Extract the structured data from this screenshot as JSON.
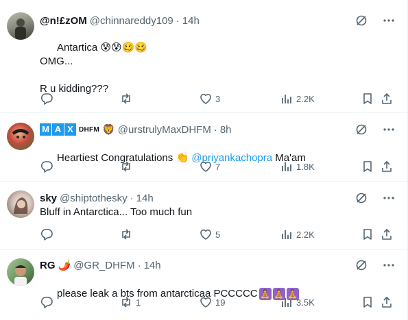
{
  "tweets": [
    {
      "name": "@n!£zOM",
      "handle": "@chinnareddy109",
      "separator": "·",
      "time": "14h",
      "text_lead": "Antartica ",
      "emojis": [
        "😰",
        "😰",
        "🥴",
        "🥴"
      ],
      "text_rest": "OMG...\n\nR u kidding???",
      "replies": "",
      "retweets": "",
      "likes": "3",
      "views": "2.2K",
      "avatar_colors": [
        "#8a8f82",
        "#3d3d35"
      ]
    },
    {
      "name_badge": [
        "M",
        "A",
        "X"
      ],
      "name_suffix": "DHFM",
      "name_emoji": "🦁",
      "handle": "@urstrulyMaxDHFM",
      "separator": "·",
      "time": "8h",
      "text_lead": "Heartiest Congratulations ",
      "emoji": "👏",
      "mention": "@priyankachopra",
      "text_tail": " Ma'am",
      "replies": "",
      "retweets": "",
      "likes": "7",
      "views": "1.8K",
      "avatar_colors": [
        "#c24a3d",
        "#2f7a3a"
      ]
    },
    {
      "name": "sky",
      "handle": "@shiptothesky",
      "separator": "·",
      "time": "14h",
      "text": "Bluff in Antarctica... Too much fun",
      "replies": "",
      "retweets": "",
      "likes": "5",
      "views": "2.2K",
      "avatar_colors": [
        "#d9c8c0",
        "#6e5449"
      ]
    },
    {
      "name": "RG",
      "name_emoji": "🌶️",
      "handle": "@GR_DHFM",
      "separator": "·",
      "time": "14h",
      "text": "please leak a bts from antarcticaa PCCCCC",
      "trailing_emojis": [
        "🧘",
        "🧘",
        "🧘"
      ],
      "replies": "",
      "retweets": "1",
      "likes": "19",
      "views": "3.5K",
      "avatar_colors": [
        "#6f9a63",
        "#3e5a36"
      ]
    }
  ],
  "icons": {
    "reply": "reply-icon",
    "retweet": "retweet-icon",
    "like": "heart-icon",
    "views": "views-icon",
    "bookmark": "bookmark-icon",
    "share": "share-icon",
    "grok": "grok-icon",
    "more": "more-icon"
  },
  "colors": {
    "text": "#0f1419",
    "secondary": "#536471",
    "accent": "#1d9bf0",
    "divider": "#eff3f4"
  }
}
